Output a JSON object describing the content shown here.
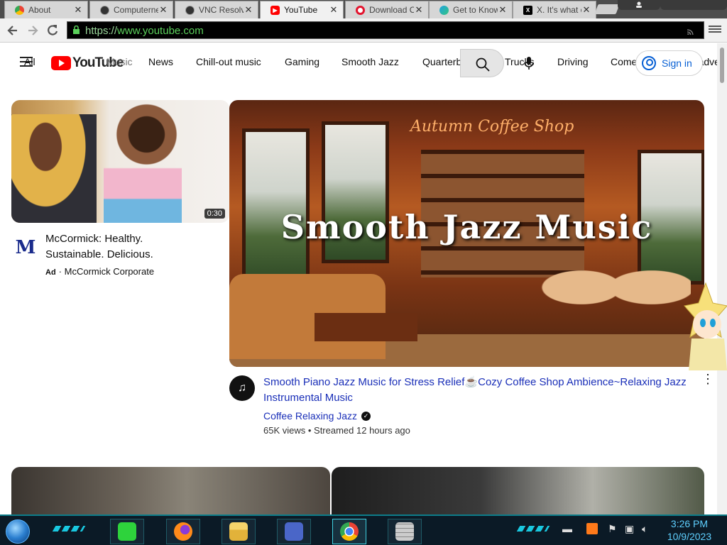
{
  "browser": {
    "tabs": [
      {
        "title": "About",
        "icon": "chrome-icon",
        "active": false
      },
      {
        "title": "Computerne",
        "icon": "vnc-icon",
        "active": false
      },
      {
        "title": "VNC Resolve",
        "icon": "vnc-icon",
        "active": false
      },
      {
        "title": "YouTube",
        "icon": "youtube-icon",
        "active": true
      },
      {
        "title": "Download O",
        "icon": "opera-icon",
        "active": false
      },
      {
        "title": "Get to Know",
        "icon": "edge-icon",
        "active": false
      },
      {
        "title": "X. It's what o",
        "icon": "x-icon",
        "active": false
      }
    ],
    "close_glyph": "✕",
    "url_scheme": "https://",
    "url_host": "www.youtube.com"
  },
  "youtube": {
    "logo_text": "YouTube",
    "chips": [
      "All",
      "Music",
      "News",
      "Chill-out music",
      "Gaming",
      "Smooth Jazz",
      "Quarterbacks",
      "Trucks",
      "Driving",
      "Comedy",
      "Action-adventure"
    ],
    "signin_label": "Sign in"
  },
  "ad": {
    "duration": "0:30",
    "title": "McCormick: Healthy. Sustainable. Delicious.",
    "ad_tag": "Ad",
    "separator": "·",
    "advertiser": "McCormick Corporate",
    "logo_text": "M"
  },
  "video": {
    "thumb_overlay_text": "Smooth Jazz Music",
    "thumb_sign_text": "Autumn Coffee Shop",
    "title": "Smooth Piano Jazz Music for Stress Relief☕Cozy Coffee Shop Ambience~Relaxing Jazz Instrumental Music",
    "channel": "Coffee Relaxing Jazz",
    "verified_glyph": "✓",
    "stats": "65K views • Streamed 12 hours ago",
    "menu_glyph": "⋮"
  },
  "taskbar": {
    "time": "3:26 PM",
    "date": "10/9/2023",
    "items": [
      "spotify-icon",
      "firefox-icon",
      "file-explorer-icon",
      "control-panel-icon",
      "chrome-icon",
      "wall-icon"
    ]
  },
  "colors": {
    "youtube_red": "#ff0000",
    "link_blue": "#065fd4",
    "url_green": "#5bd15b",
    "taskbar_accent": "#19c8e0"
  }
}
